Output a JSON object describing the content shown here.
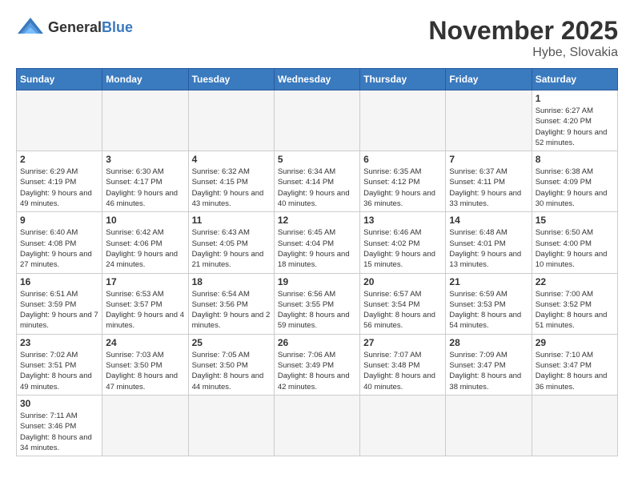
{
  "logo": {
    "text_general": "General",
    "text_blue": "Blue"
  },
  "title": "November 2025",
  "location": "Hybe, Slovakia",
  "days_of_week": [
    "Sunday",
    "Monday",
    "Tuesday",
    "Wednesday",
    "Thursday",
    "Friday",
    "Saturday"
  ],
  "weeks": [
    [
      {
        "day": "",
        "info": ""
      },
      {
        "day": "",
        "info": ""
      },
      {
        "day": "",
        "info": ""
      },
      {
        "day": "",
        "info": ""
      },
      {
        "day": "",
        "info": ""
      },
      {
        "day": "",
        "info": ""
      },
      {
        "day": "1",
        "info": "Sunrise: 6:27 AM\nSunset: 4:20 PM\nDaylight: 9 hours and 52 minutes."
      }
    ],
    [
      {
        "day": "2",
        "info": "Sunrise: 6:29 AM\nSunset: 4:19 PM\nDaylight: 9 hours and 49 minutes."
      },
      {
        "day": "3",
        "info": "Sunrise: 6:30 AM\nSunset: 4:17 PM\nDaylight: 9 hours and 46 minutes."
      },
      {
        "day": "4",
        "info": "Sunrise: 6:32 AM\nSunset: 4:15 PM\nDaylight: 9 hours and 43 minutes."
      },
      {
        "day": "5",
        "info": "Sunrise: 6:34 AM\nSunset: 4:14 PM\nDaylight: 9 hours and 40 minutes."
      },
      {
        "day": "6",
        "info": "Sunrise: 6:35 AM\nSunset: 4:12 PM\nDaylight: 9 hours and 36 minutes."
      },
      {
        "day": "7",
        "info": "Sunrise: 6:37 AM\nSunset: 4:11 PM\nDaylight: 9 hours and 33 minutes."
      },
      {
        "day": "8",
        "info": "Sunrise: 6:38 AM\nSunset: 4:09 PM\nDaylight: 9 hours and 30 minutes."
      }
    ],
    [
      {
        "day": "9",
        "info": "Sunrise: 6:40 AM\nSunset: 4:08 PM\nDaylight: 9 hours and 27 minutes."
      },
      {
        "day": "10",
        "info": "Sunrise: 6:42 AM\nSunset: 4:06 PM\nDaylight: 9 hours and 24 minutes."
      },
      {
        "day": "11",
        "info": "Sunrise: 6:43 AM\nSunset: 4:05 PM\nDaylight: 9 hours and 21 minutes."
      },
      {
        "day": "12",
        "info": "Sunrise: 6:45 AM\nSunset: 4:04 PM\nDaylight: 9 hours and 18 minutes."
      },
      {
        "day": "13",
        "info": "Sunrise: 6:46 AM\nSunset: 4:02 PM\nDaylight: 9 hours and 15 minutes."
      },
      {
        "day": "14",
        "info": "Sunrise: 6:48 AM\nSunset: 4:01 PM\nDaylight: 9 hours and 13 minutes."
      },
      {
        "day": "15",
        "info": "Sunrise: 6:50 AM\nSunset: 4:00 PM\nDaylight: 9 hours and 10 minutes."
      }
    ],
    [
      {
        "day": "16",
        "info": "Sunrise: 6:51 AM\nSunset: 3:59 PM\nDaylight: 9 hours and 7 minutes."
      },
      {
        "day": "17",
        "info": "Sunrise: 6:53 AM\nSunset: 3:57 PM\nDaylight: 9 hours and 4 minutes."
      },
      {
        "day": "18",
        "info": "Sunrise: 6:54 AM\nSunset: 3:56 PM\nDaylight: 9 hours and 2 minutes."
      },
      {
        "day": "19",
        "info": "Sunrise: 6:56 AM\nSunset: 3:55 PM\nDaylight: 8 hours and 59 minutes."
      },
      {
        "day": "20",
        "info": "Sunrise: 6:57 AM\nSunset: 3:54 PM\nDaylight: 8 hours and 56 minutes."
      },
      {
        "day": "21",
        "info": "Sunrise: 6:59 AM\nSunset: 3:53 PM\nDaylight: 8 hours and 54 minutes."
      },
      {
        "day": "22",
        "info": "Sunrise: 7:00 AM\nSunset: 3:52 PM\nDaylight: 8 hours and 51 minutes."
      }
    ],
    [
      {
        "day": "23",
        "info": "Sunrise: 7:02 AM\nSunset: 3:51 PM\nDaylight: 8 hours and 49 minutes."
      },
      {
        "day": "24",
        "info": "Sunrise: 7:03 AM\nSunset: 3:50 PM\nDaylight: 8 hours and 47 minutes."
      },
      {
        "day": "25",
        "info": "Sunrise: 7:05 AM\nSunset: 3:50 PM\nDaylight: 8 hours and 44 minutes."
      },
      {
        "day": "26",
        "info": "Sunrise: 7:06 AM\nSunset: 3:49 PM\nDaylight: 8 hours and 42 minutes."
      },
      {
        "day": "27",
        "info": "Sunrise: 7:07 AM\nSunset: 3:48 PM\nDaylight: 8 hours and 40 minutes."
      },
      {
        "day": "28",
        "info": "Sunrise: 7:09 AM\nSunset: 3:47 PM\nDaylight: 8 hours and 38 minutes."
      },
      {
        "day": "29",
        "info": "Sunrise: 7:10 AM\nSunset: 3:47 PM\nDaylight: 8 hours and 36 minutes."
      }
    ],
    [
      {
        "day": "30",
        "info": "Sunrise: 7:11 AM\nSunset: 3:46 PM\nDaylight: 8 hours and 34 minutes."
      },
      {
        "day": "",
        "info": ""
      },
      {
        "day": "",
        "info": ""
      },
      {
        "day": "",
        "info": ""
      },
      {
        "day": "",
        "info": ""
      },
      {
        "day": "",
        "info": ""
      },
      {
        "day": "",
        "info": ""
      }
    ]
  ]
}
